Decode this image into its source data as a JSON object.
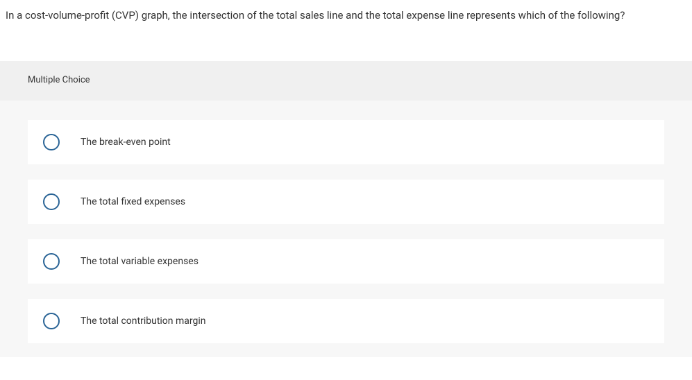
{
  "question": {
    "text": "In a cost-volume-profit (CVP) graph, the intersection of the total sales line and the total expense line represents which of the following?"
  },
  "section_label": "Multiple Choice",
  "options": [
    {
      "label": "The break-even point"
    },
    {
      "label": "The total fixed expenses"
    },
    {
      "label": "The total variable expenses"
    },
    {
      "label": "The total contribution margin"
    }
  ]
}
